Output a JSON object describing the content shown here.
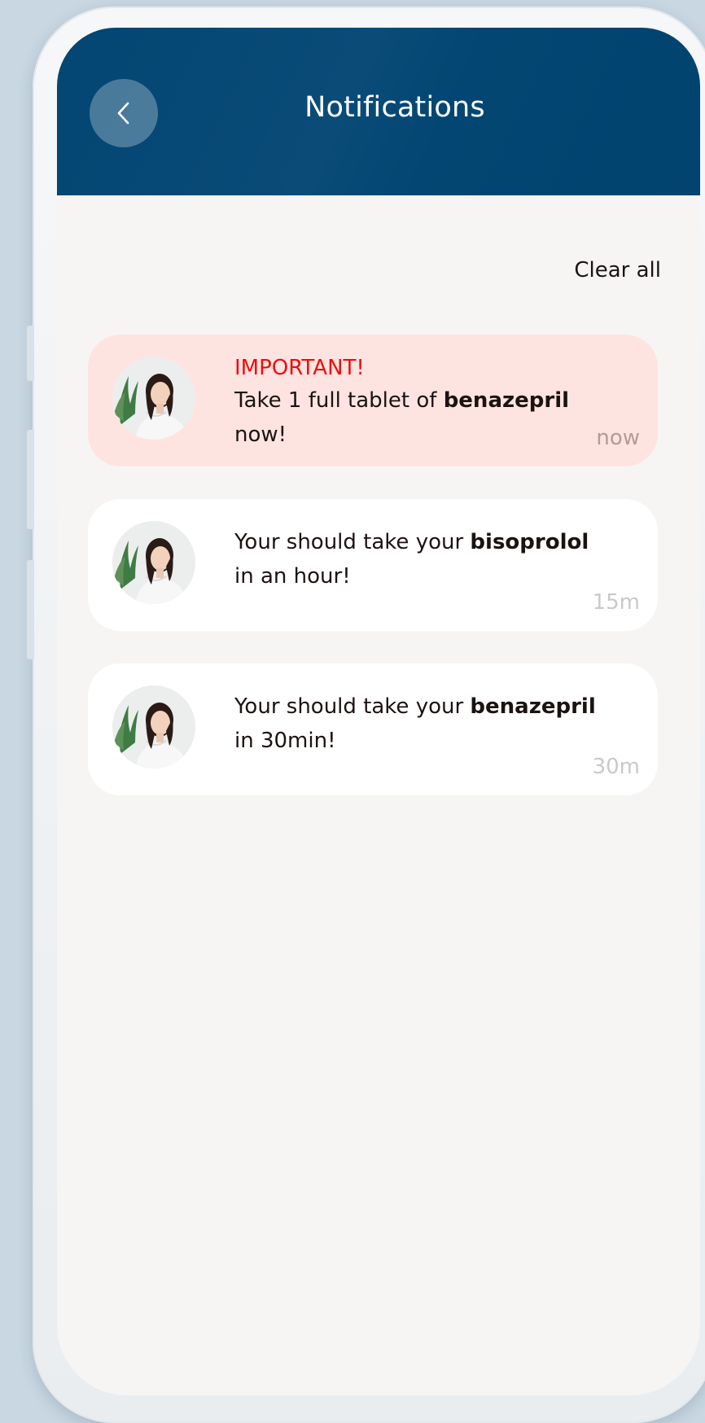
{
  "header": {
    "title": "Notifications",
    "back_icon": "chevron-left-icon",
    "bg_color": "#034673"
  },
  "actions": {
    "clear_all_label": "Clear all"
  },
  "notifications": [
    {
      "important": true,
      "badge": "IMPORTANT!",
      "text_before": "Take 1 full tablet of ",
      "medication": "benazepril",
      "text_after": " now!",
      "time": "now",
      "bg_color": "#fee4e0"
    },
    {
      "important": false,
      "text_before": "Your should take your ",
      "medication": "bisoprolol",
      "text_after": " in an hour!",
      "time": "15m",
      "bg_color": "#ffffff"
    },
    {
      "important": false,
      "text_before": "Your should take your ",
      "medication": "benazepril",
      "text_after": " in 30min!",
      "time": "30m",
      "bg_color": "#ffffff"
    }
  ],
  "colors": {
    "important_text": "#f00d0d",
    "body_text": "#1b1311",
    "screen_bg": "#f6f5f3"
  }
}
